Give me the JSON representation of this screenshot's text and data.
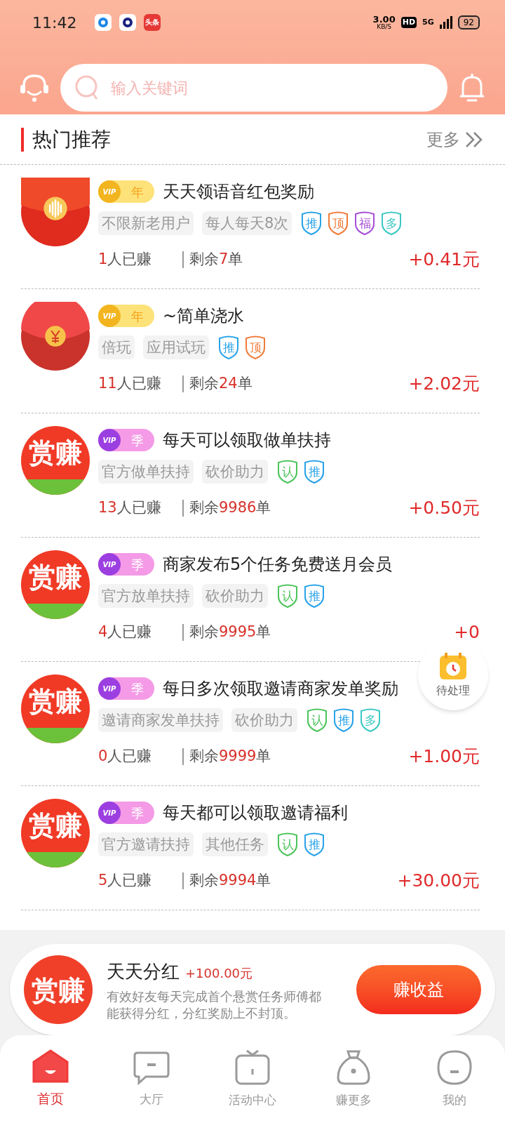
{
  "status_bar": {
    "time": "11:42",
    "net_speed": "3.00",
    "net_unit": "KB/S",
    "hd": "HD",
    "network": "5G",
    "battery": "92",
    "app_icons": [
      {
        "kind": "blue-ring"
      },
      {
        "kind": "dark-ring"
      },
      {
        "kind": "news",
        "label": "头条"
      }
    ]
  },
  "search": {
    "placeholder": "输入关键词"
  },
  "section": {
    "title": "热门推荐",
    "more": "更多"
  },
  "tasks": [
    {
      "avatar": {
        "kind": "voice"
      },
      "title": "天天领语音红包奖励",
      "vip": {
        "label": "VIP",
        "tier": "年",
        "kind": "gold"
      },
      "tags": [
        "不限新老用户",
        "每人每天8次"
      ],
      "badges": [
        {
          "label": "推",
          "color": "#29a3e8"
        },
        {
          "label": "顶",
          "color": "#f07c3a"
        },
        {
          "label": "福",
          "color": "#a64fd6"
        },
        {
          "label": "多",
          "color": "#3cc8c4"
        }
      ],
      "joined": "1",
      "joined_label": "人已赚",
      "remaining_prefix": "剩余",
      "remaining": "7",
      "remaining_suffix": "单",
      "reward": "+0.41元"
    },
    {
      "avatar": {
        "kind": "yuan"
      },
      "title": "~简单浇水",
      "vip": {
        "label": "VIP",
        "tier": "年",
        "kind": "gold"
      },
      "tags": [
        "倍玩",
        "应用试玩"
      ],
      "badges": [
        {
          "label": "推",
          "color": "#29a3e8"
        },
        {
          "label": "顶",
          "color": "#f07c3a"
        }
      ],
      "joined": "11",
      "joined_label": "人已赚",
      "remaining_prefix": "剩余",
      "remaining": "24",
      "remaining_suffix": "单",
      "reward": "+2.02元"
    },
    {
      "avatar": {
        "kind": "logo",
        "text": "赏赚"
      },
      "title": "每天可以领取做单扶持",
      "vip": {
        "label": "VIP",
        "tier": "季",
        "kind": "purple"
      },
      "tags": [
        "官方做单扶持",
        "砍价助力"
      ],
      "badges": [
        {
          "label": "认",
          "color": "#4cc45a"
        },
        {
          "label": "推",
          "color": "#29a3e8"
        }
      ],
      "joined": "13",
      "joined_label": "人已赚",
      "remaining_prefix": "剩余",
      "remaining": "9986",
      "remaining_suffix": "单",
      "reward": "+0.50元"
    },
    {
      "avatar": {
        "kind": "logo",
        "text": "赏赚"
      },
      "title": "商家发布5个任务免费送月会员",
      "vip": {
        "label": "VIP",
        "tier": "季",
        "kind": "purple"
      },
      "tags": [
        "官方放单扶持",
        "砍价助力"
      ],
      "badges": [
        {
          "label": "认",
          "color": "#4cc45a"
        },
        {
          "label": "推",
          "color": "#29a3e8"
        }
      ],
      "joined": "4",
      "joined_label": "人已赚",
      "remaining_prefix": "剩余",
      "remaining": "9995",
      "remaining_suffix": "单",
      "reward": "+0"
    },
    {
      "avatar": {
        "kind": "logo",
        "text": "赏赚"
      },
      "title": "每日多次领取邀请商家发单奖励",
      "vip": {
        "label": "VIP",
        "tier": "季",
        "kind": "purple"
      },
      "tags": [
        "邀请商家发单扶持",
        "砍价助力"
      ],
      "badges": [
        {
          "label": "认",
          "color": "#4cc45a"
        },
        {
          "label": "推",
          "color": "#29a3e8"
        },
        {
          "label": "多",
          "color": "#3cc8c4"
        }
      ],
      "joined": "0",
      "joined_label": "人已赚",
      "remaining_prefix": "剩余",
      "remaining": "9999",
      "remaining_suffix": "单",
      "reward": "+1.00元"
    },
    {
      "avatar": {
        "kind": "logo",
        "text": "赏赚"
      },
      "title": "每天都可以领取邀请福利",
      "vip": {
        "label": "VIP",
        "tier": "季",
        "kind": "purple"
      },
      "tags": [
        "官方邀请扶持",
        "其他任务"
      ],
      "badges": [
        {
          "label": "认",
          "color": "#4cc45a"
        },
        {
          "label": "推",
          "color": "#29a3e8"
        }
      ],
      "joined": "5",
      "joined_label": "人已赚",
      "remaining_prefix": "剩余",
      "remaining": "9994",
      "remaining_suffix": "单",
      "reward": "+30.00元"
    }
  ],
  "floating_button": {
    "label": "待处理"
  },
  "promo": {
    "logo_text": "赏赚",
    "title": "天天分红",
    "amount": "+100.00元",
    "description": "有效好友每天完成首个悬赏任务师傅都能获得分红，分红奖励上不封顶。",
    "button": "赚收益"
  },
  "nav": [
    {
      "kind": "home",
      "label": "首页",
      "selected": true
    },
    {
      "kind": "hall",
      "label": "大厅",
      "selected": false
    },
    {
      "kind": "activity",
      "label": "活动中心",
      "selected": false
    },
    {
      "kind": "bag",
      "label": "赚更多",
      "selected": false
    },
    {
      "kind": "me",
      "label": "我的",
      "selected": false
    }
  ]
}
